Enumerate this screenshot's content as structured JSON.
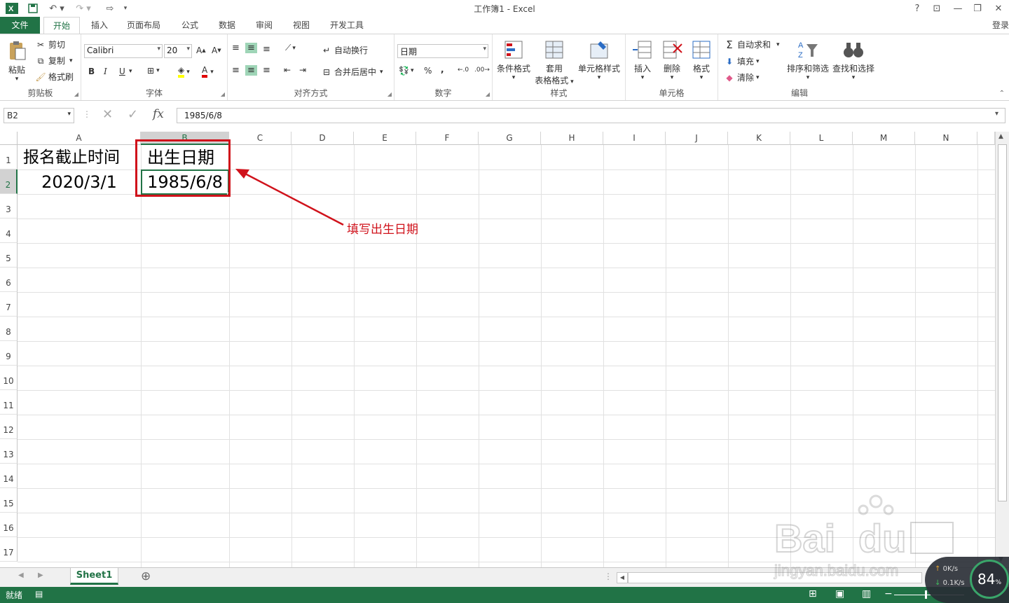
{
  "window": {
    "title": "工作簿1 - Excel",
    "help": "?",
    "login": "登录"
  },
  "tabs": [
    "文件",
    "开始",
    "插入",
    "页面布局",
    "公式",
    "数据",
    "审阅",
    "视图",
    "开发工具"
  ],
  "ribbon": {
    "clipboard": {
      "label": "剪贴板",
      "paste": "粘贴",
      "cut": "剪切",
      "copy": "复制",
      "format_painter": "格式刷"
    },
    "font": {
      "label": "字体",
      "font_name": "Calibri",
      "font_size": "20",
      "bold": "B",
      "italic": "I",
      "underline": "U",
      "font_color_letter": "A"
    },
    "alignment": {
      "label": "对齐方式",
      "wrap_text": "自动换行",
      "merge_center": "合并后居中"
    },
    "number": {
      "label": "数字",
      "format": "日期",
      "percent": "%",
      "comma": ","
    },
    "styles": {
      "label": "样式",
      "conditional": "条件格式",
      "table_format_1": "套用",
      "table_format_2": "表格格式",
      "cell_styles": "单元格样式"
    },
    "cells": {
      "label": "单元格",
      "insert": "插入",
      "delete": "删除",
      "format": "格式"
    },
    "editing": {
      "label": "编辑",
      "autosum": "自动求和",
      "fill": "填充",
      "clear": "清除",
      "sort_filter": "排序和筛选",
      "find_select": "查找和选择"
    }
  },
  "formula_bar": {
    "name_box": "B2",
    "fx": "fx",
    "value": "1985/6/8"
  },
  "columns": [
    "A",
    "B",
    "C",
    "D",
    "E",
    "F",
    "G",
    "H",
    "I",
    "J",
    "K",
    "L",
    "M",
    "N"
  ],
  "rows": [
    "1",
    "2",
    "3",
    "4",
    "5",
    "6",
    "7",
    "8",
    "9",
    "10",
    "11",
    "12",
    "13",
    "14",
    "15",
    "16",
    "17"
  ],
  "cells": {
    "A1": "报名截止时间",
    "B1": "出生日期",
    "A2": "2020/3/1",
    "B2": "1985/6/8"
  },
  "annotation": {
    "text": "填写出生日期",
    "color": "#d0121b"
  },
  "sheet": {
    "name": "Sheet1",
    "add": "⊕"
  },
  "status": {
    "text": "就绪"
  },
  "overlay": {
    "percent": "84",
    "percent_unit": "%",
    "up": "0K/s",
    "down": "0.1K/s"
  },
  "colors": {
    "excel_green": "#217346",
    "selection": "#d2d2d2"
  }
}
